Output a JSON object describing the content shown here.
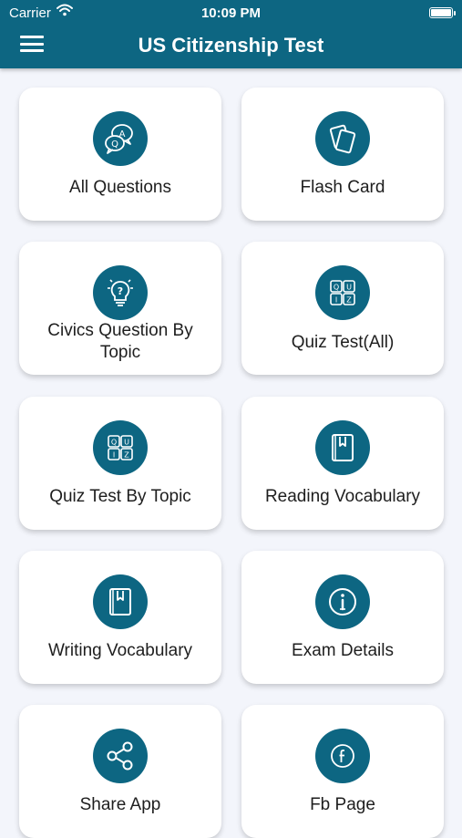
{
  "status_bar": {
    "carrier": "Carrier",
    "time": "10:09 PM"
  },
  "header": {
    "title": "US Citizenship Test",
    "menu_icon": "hamburger-menu-icon"
  },
  "colors": {
    "primary": "#0d6682",
    "background": "#f3f5fb",
    "card": "#ffffff"
  },
  "tiles": [
    {
      "label": "All Questions",
      "icon": "question-bubbles-icon"
    },
    {
      "label": "Flash Card",
      "icon": "flash-cards-icon"
    },
    {
      "label": "Civics Question By Topic",
      "icon": "lightbulb-question-icon"
    },
    {
      "label": "Quiz Test(All)",
      "icon": "quiz-grid-icon"
    },
    {
      "label": "Quiz Test By Topic",
      "icon": "quiz-grid-icon"
    },
    {
      "label": "Reading Vocabulary",
      "icon": "book-icon"
    },
    {
      "label": "Writing Vocabulary",
      "icon": "book-icon"
    },
    {
      "label": "Exam Details",
      "icon": "info-icon"
    },
    {
      "label": "Share App",
      "icon": "share-icon"
    },
    {
      "label": "Fb Page",
      "icon": "facebook-icon"
    }
  ],
  "quiz_letters": [
    "Q",
    "U",
    "I",
    "Z"
  ]
}
